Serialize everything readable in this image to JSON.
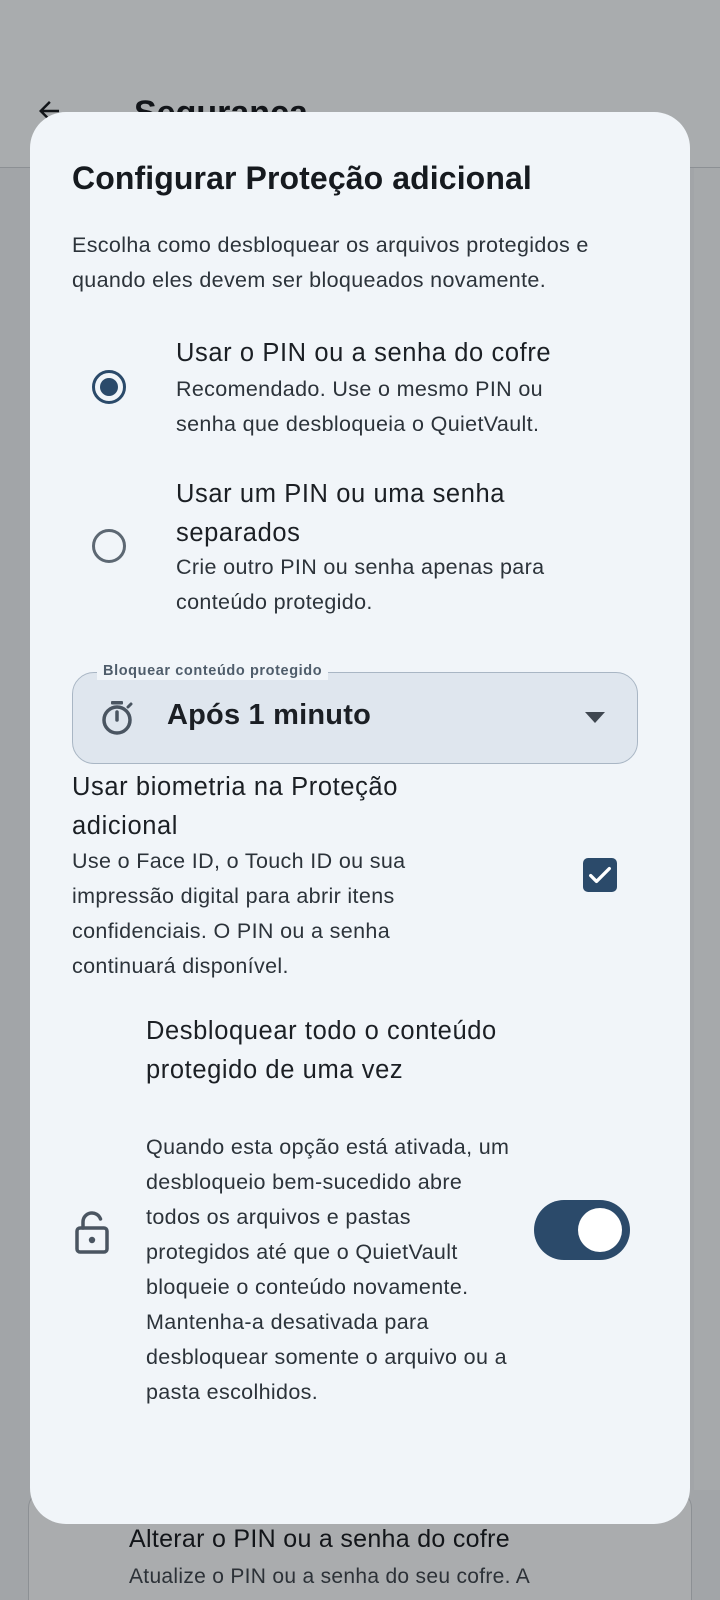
{
  "background": {
    "page_title": "Segurança",
    "card_title": "Alterar o PIN ou a senha do cofre",
    "card_subtitle": "Atualize o PIN ou a senha do seu cofre. A"
  },
  "dialog": {
    "title": "Configurar Proteção adicional",
    "description": "Escolha como desbloquear os arquivos protegidos e quando eles devem ser bloqueados novamente.",
    "options": [
      {
        "title": "Usar o PIN ou a senha do cofre",
        "subtitle": "Recomendado. Use o mesmo PIN ou senha que desbloqueia o QuietVault.",
        "selected": true
      },
      {
        "title": "Usar um PIN ou uma senha separados",
        "subtitle": "Crie outro PIN ou senha apenas para conteúdo protegido.",
        "selected": false
      }
    ],
    "lock_dropdown": {
      "label": "Bloquear conteúdo protegido",
      "value": "Após 1 minuto",
      "icon": "timer-icon"
    },
    "biometrics": {
      "title": "Usar biometria na Proteção adicional",
      "subtitle": "Use o Face ID, o Touch ID ou sua impressão digital para abrir itens confidenciais. O PIN ou a senha continuará disponível.",
      "checked": true
    },
    "unlock_all": {
      "title": "Desbloquear todo o conteúdo protegido de uma vez",
      "subtitle": "Quando esta opção está ativada, um desbloqueio bem-sucedido abre todos os arquivos e pastas protegidos até que o QuietVault bloqueie o conteúdo novamente. Mantenha-a desativada para desbloquear somente o arquivo ou a pasta escolhidos.",
      "enabled": true,
      "icon": "lock-icon"
    }
  },
  "colors": {
    "accent": "#2b4a6a",
    "dialog_bg": "#f1f5f9",
    "scrim": "rgba(0,0,0,0.30)"
  }
}
